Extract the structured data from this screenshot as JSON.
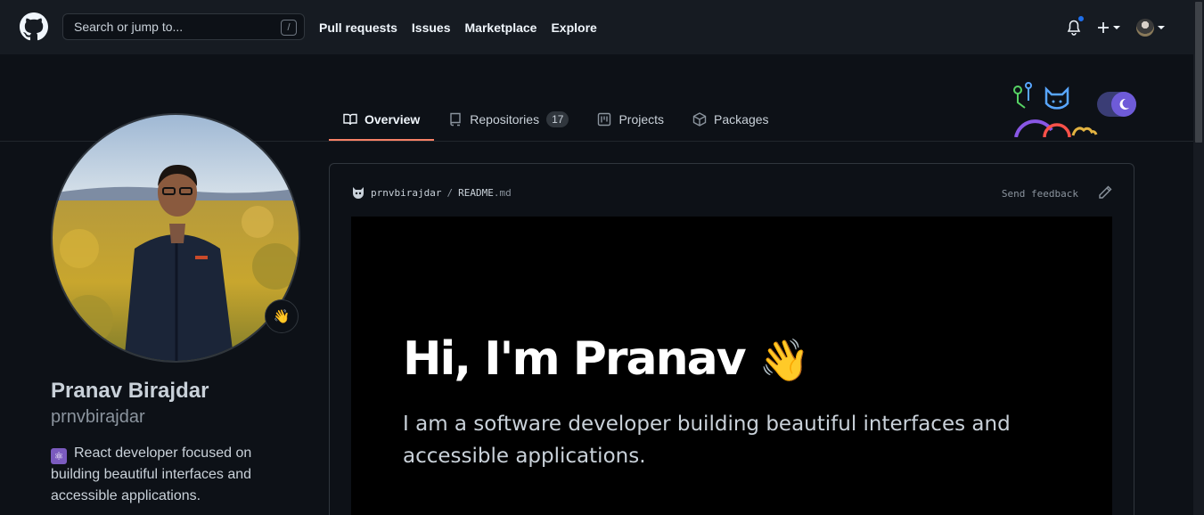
{
  "header": {
    "search_placeholder": "Search or jump to...",
    "search_shortcut": "/",
    "nav": [
      "Pull requests",
      "Issues",
      "Marketplace",
      "Explore"
    ]
  },
  "tabs": [
    {
      "label": "Overview",
      "active": true
    },
    {
      "label": "Repositories",
      "count": "17"
    },
    {
      "label": "Projects"
    },
    {
      "label": "Packages"
    }
  ],
  "profile": {
    "name": "Pranav Birajdar",
    "login": "prnvbirajdar",
    "status_emoji": "👋",
    "bio": "React developer focused on building beautiful interfaces and accessible applications."
  },
  "readme": {
    "owner": "prnvbirajdar",
    "separator": "/",
    "file_name": "README",
    "file_ext": ".md",
    "feedback": "Send feedback",
    "heading": "Hi, I'm Pranav",
    "heading_emoji": "👋",
    "subtitle": "I am a software developer building beautiful interfaces and accessible applications."
  },
  "colors": {
    "background": "#0d1117",
    "header": "#161b22",
    "active_tab": "#f78166",
    "notification_dot": "#1f6feb",
    "toggle": "#6e5bd8"
  }
}
